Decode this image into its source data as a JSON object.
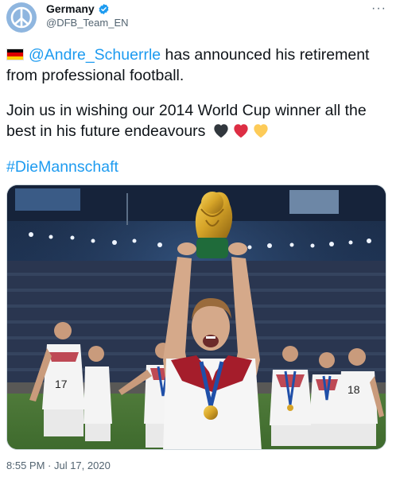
{
  "account": {
    "name": "Germany",
    "handle": "@DFB_Team_EN",
    "verified_icon": "verified-badge-icon",
    "avatar_icon": "peace-symbol-icon"
  },
  "tweet": {
    "mention": "@Andre_Schuerrle",
    "line1_rest": " has announced his retirement",
    "line2": "from professional football.",
    "line3": "Join us in wishing our 2014 World Cup winner all the",
    "line4": "best in his future endeavours",
    "hashtag": "#DieMannschaft",
    "emoji": [
      "german-flag-icon",
      "black-heart-icon",
      "red-heart-icon",
      "yellow-heart-icon"
    ]
  },
  "photo": {
    "description_icon": "world-cup-celebration-photo",
    "jersey_numbers": [
      "17",
      "18"
    ]
  },
  "meta": {
    "timestamp": "8:55 PM · Jul 17, 2020"
  },
  "colors": {
    "link": "#1d9bf0",
    "verified": "#1d9bf0",
    "secondary_text": "#536471"
  }
}
